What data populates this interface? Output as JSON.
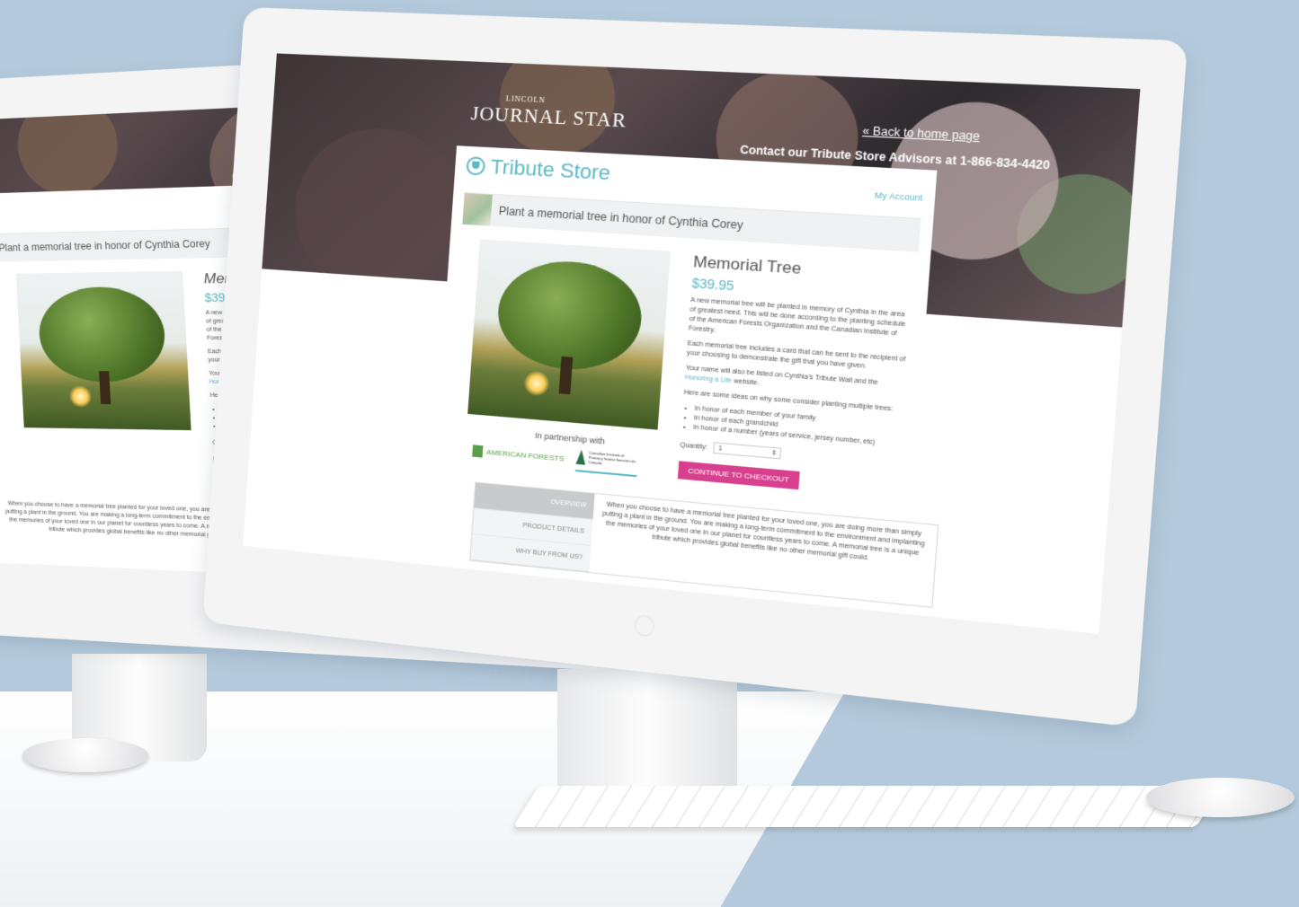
{
  "header": {
    "brand_top": "LINCOLN",
    "brand": "JOURNAL STAR",
    "back_link": "« Back to home page",
    "contact": "Contact our Tribute Store Advisors at 1-866-834-4420"
  },
  "store": {
    "title": "Tribute Store",
    "my_account": "My Account",
    "honor_text": "Plant a memorial tree in honor of Cynthia Corey"
  },
  "product": {
    "title": "Memorial Tree",
    "price": "$39.95",
    "desc1": "A new memorial tree will be planted in memory of Cynthia in the area of greatest need. This will be done according to the planting schedule of the American Forests Organization and the Canadian Institute of Forestry.",
    "desc2": "Each memorial tree includes a card that can be sent to the recipient of your choosing to demonstrate the gift that you have given.",
    "desc3_pre": "Your name will also be listed on Cynthia's Tribute Wall and the",
    "desc3_link": "Honoring a Life",
    "desc3_post": "website.",
    "ideas_intro": "Here are some ideas on why some consider planting multiple trees:",
    "ideas": [
      "In honor of each member of your family",
      "In honor of each grandchild",
      "In honor of a number (years of service, jersey number, etc)"
    ],
    "quantity_label": "Quantity:",
    "quantity_value": "1",
    "checkout_label": "CONTINUE TO CHECKOUT"
  },
  "partners": {
    "label": "In partnership with",
    "american_forests": "AMERICAN FORESTS",
    "cif": "Canadian Institute of Forestry Institut forestier du Canada"
  },
  "tabs": {
    "items": [
      "OVERVIEW",
      "PRODUCT DETAILS",
      "WHY BUY FROM US?"
    ],
    "overview_text": "When you choose to have a memorial tree planted for your loved one, you are doing more than simply putting a plant in the ground. You are making a long-term commitment to the environment and implanting the memories of your loved one in our planet for countless years to come. A memorial tree is a unique tribute which provides global benefits like no other memorial gift could."
  },
  "colors": {
    "accent": "#5bb8c4",
    "button": "#d8408f",
    "background": "#b4cadc"
  },
  "icons": {
    "store": "tribute-store-icon",
    "apple": "apple-logo-icon"
  }
}
